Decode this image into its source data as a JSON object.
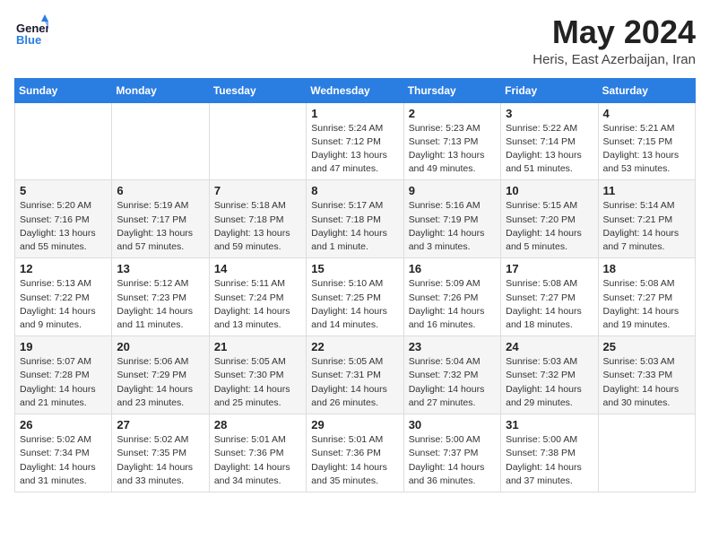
{
  "logo": {
    "general": "General",
    "blue": "Blue"
  },
  "title": {
    "month_year": "May 2024",
    "location": "Heris, East Azerbaijan, Iran"
  },
  "days_of_week": [
    "Sunday",
    "Monday",
    "Tuesday",
    "Wednesday",
    "Thursday",
    "Friday",
    "Saturday"
  ],
  "weeks": [
    [
      {
        "day": "",
        "sunrise": "",
        "sunset": "",
        "daylight": ""
      },
      {
        "day": "",
        "sunrise": "",
        "sunset": "",
        "daylight": ""
      },
      {
        "day": "",
        "sunrise": "",
        "sunset": "",
        "daylight": ""
      },
      {
        "day": "1",
        "sunrise": "Sunrise: 5:24 AM",
        "sunset": "Sunset: 7:12 PM",
        "daylight": "Daylight: 13 hours and 47 minutes."
      },
      {
        "day": "2",
        "sunrise": "Sunrise: 5:23 AM",
        "sunset": "Sunset: 7:13 PM",
        "daylight": "Daylight: 13 hours and 49 minutes."
      },
      {
        "day": "3",
        "sunrise": "Sunrise: 5:22 AM",
        "sunset": "Sunset: 7:14 PM",
        "daylight": "Daylight: 13 hours and 51 minutes."
      },
      {
        "day": "4",
        "sunrise": "Sunrise: 5:21 AM",
        "sunset": "Sunset: 7:15 PM",
        "daylight": "Daylight: 13 hours and 53 minutes."
      }
    ],
    [
      {
        "day": "5",
        "sunrise": "Sunrise: 5:20 AM",
        "sunset": "Sunset: 7:16 PM",
        "daylight": "Daylight: 13 hours and 55 minutes."
      },
      {
        "day": "6",
        "sunrise": "Sunrise: 5:19 AM",
        "sunset": "Sunset: 7:17 PM",
        "daylight": "Daylight: 13 hours and 57 minutes."
      },
      {
        "day": "7",
        "sunrise": "Sunrise: 5:18 AM",
        "sunset": "Sunset: 7:18 PM",
        "daylight": "Daylight: 13 hours and 59 minutes."
      },
      {
        "day": "8",
        "sunrise": "Sunrise: 5:17 AM",
        "sunset": "Sunset: 7:18 PM",
        "daylight": "Daylight: 14 hours and 1 minute."
      },
      {
        "day": "9",
        "sunrise": "Sunrise: 5:16 AM",
        "sunset": "Sunset: 7:19 PM",
        "daylight": "Daylight: 14 hours and 3 minutes."
      },
      {
        "day": "10",
        "sunrise": "Sunrise: 5:15 AM",
        "sunset": "Sunset: 7:20 PM",
        "daylight": "Daylight: 14 hours and 5 minutes."
      },
      {
        "day": "11",
        "sunrise": "Sunrise: 5:14 AM",
        "sunset": "Sunset: 7:21 PM",
        "daylight": "Daylight: 14 hours and 7 minutes."
      }
    ],
    [
      {
        "day": "12",
        "sunrise": "Sunrise: 5:13 AM",
        "sunset": "Sunset: 7:22 PM",
        "daylight": "Daylight: 14 hours and 9 minutes."
      },
      {
        "day": "13",
        "sunrise": "Sunrise: 5:12 AM",
        "sunset": "Sunset: 7:23 PM",
        "daylight": "Daylight: 14 hours and 11 minutes."
      },
      {
        "day": "14",
        "sunrise": "Sunrise: 5:11 AM",
        "sunset": "Sunset: 7:24 PM",
        "daylight": "Daylight: 14 hours and 13 minutes."
      },
      {
        "day": "15",
        "sunrise": "Sunrise: 5:10 AM",
        "sunset": "Sunset: 7:25 PM",
        "daylight": "Daylight: 14 hours and 14 minutes."
      },
      {
        "day": "16",
        "sunrise": "Sunrise: 5:09 AM",
        "sunset": "Sunset: 7:26 PM",
        "daylight": "Daylight: 14 hours and 16 minutes."
      },
      {
        "day": "17",
        "sunrise": "Sunrise: 5:08 AM",
        "sunset": "Sunset: 7:27 PM",
        "daylight": "Daylight: 14 hours and 18 minutes."
      },
      {
        "day": "18",
        "sunrise": "Sunrise: 5:08 AM",
        "sunset": "Sunset: 7:27 PM",
        "daylight": "Daylight: 14 hours and 19 minutes."
      }
    ],
    [
      {
        "day": "19",
        "sunrise": "Sunrise: 5:07 AM",
        "sunset": "Sunset: 7:28 PM",
        "daylight": "Daylight: 14 hours and 21 minutes."
      },
      {
        "day": "20",
        "sunrise": "Sunrise: 5:06 AM",
        "sunset": "Sunset: 7:29 PM",
        "daylight": "Daylight: 14 hours and 23 minutes."
      },
      {
        "day": "21",
        "sunrise": "Sunrise: 5:05 AM",
        "sunset": "Sunset: 7:30 PM",
        "daylight": "Daylight: 14 hours and 25 minutes."
      },
      {
        "day": "22",
        "sunrise": "Sunrise: 5:05 AM",
        "sunset": "Sunset: 7:31 PM",
        "daylight": "Daylight: 14 hours and 26 minutes."
      },
      {
        "day": "23",
        "sunrise": "Sunrise: 5:04 AM",
        "sunset": "Sunset: 7:32 PM",
        "daylight": "Daylight: 14 hours and 27 minutes."
      },
      {
        "day": "24",
        "sunrise": "Sunrise: 5:03 AM",
        "sunset": "Sunset: 7:32 PM",
        "daylight": "Daylight: 14 hours and 29 minutes."
      },
      {
        "day": "25",
        "sunrise": "Sunrise: 5:03 AM",
        "sunset": "Sunset: 7:33 PM",
        "daylight": "Daylight: 14 hours and 30 minutes."
      }
    ],
    [
      {
        "day": "26",
        "sunrise": "Sunrise: 5:02 AM",
        "sunset": "Sunset: 7:34 PM",
        "daylight": "Daylight: 14 hours and 31 minutes."
      },
      {
        "day": "27",
        "sunrise": "Sunrise: 5:02 AM",
        "sunset": "Sunset: 7:35 PM",
        "daylight": "Daylight: 14 hours and 33 minutes."
      },
      {
        "day": "28",
        "sunrise": "Sunrise: 5:01 AM",
        "sunset": "Sunset: 7:36 PM",
        "daylight": "Daylight: 14 hours and 34 minutes."
      },
      {
        "day": "29",
        "sunrise": "Sunrise: 5:01 AM",
        "sunset": "Sunset: 7:36 PM",
        "daylight": "Daylight: 14 hours and 35 minutes."
      },
      {
        "day": "30",
        "sunrise": "Sunrise: 5:00 AM",
        "sunset": "Sunset: 7:37 PM",
        "daylight": "Daylight: 14 hours and 36 minutes."
      },
      {
        "day": "31",
        "sunrise": "Sunrise: 5:00 AM",
        "sunset": "Sunset: 7:38 PM",
        "daylight": "Daylight: 14 hours and 37 minutes."
      },
      {
        "day": "",
        "sunrise": "",
        "sunset": "",
        "daylight": ""
      }
    ]
  ]
}
